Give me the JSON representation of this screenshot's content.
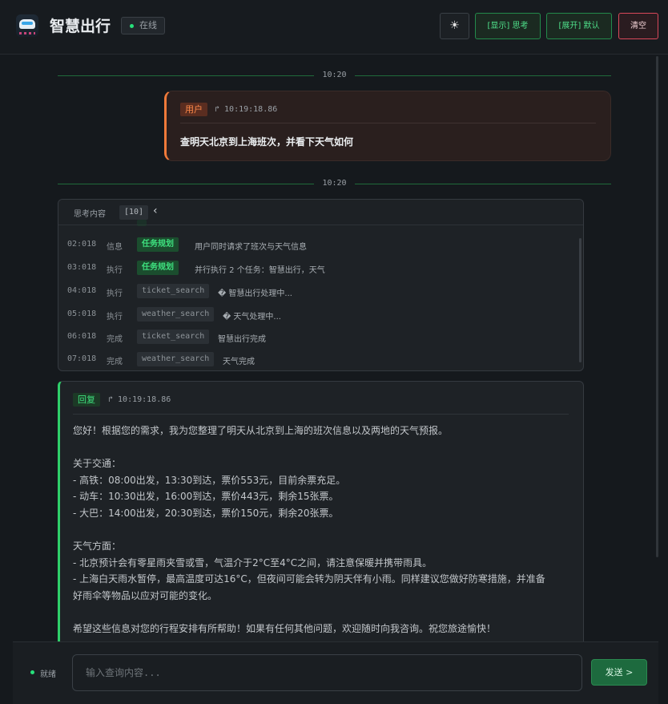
{
  "header": {
    "title": "智慧出行",
    "status": "在线",
    "theme_icon": "☀",
    "btn_think": "[显示] 思考",
    "btn_expand": "[展开] 默认",
    "btn_clear": "清空"
  },
  "dividers": [
    "10:20",
    "10:20"
  ],
  "user_message": {
    "tag": "用户",
    "time": "↱ 10:19:18.86",
    "text": "查明天北京到上海班次，并看下天气如何"
  },
  "thinking": {
    "label": "思考内容",
    "count": "[10]",
    "rows": [
      {
        "time": "02:018",
        "type": "信息",
        "tag": "任务规划",
        "tag_kind": "plan",
        "text": "用户同时请求了班次与天气信息"
      },
      {
        "time": "03:018",
        "type": "执行",
        "tag": "任务规划",
        "tag_kind": "plan",
        "text": "并行执行 2 个任务：智慧出行，天气"
      },
      {
        "time": "04:018",
        "type": "执行",
        "tag": "ticket_search",
        "tag_kind": "tool",
        "text": "� 智慧出行处理中..."
      },
      {
        "time": "05:018",
        "type": "执行",
        "tag": "weather_search",
        "tag_kind": "tool",
        "text": "� 天气处理中..."
      },
      {
        "time": "06:018",
        "type": "完成",
        "tag": "ticket_search",
        "tag_kind": "tool",
        "text": "智慧出行完成"
      },
      {
        "time": "07:018",
        "type": "完成",
        "tag": "weather_search",
        "tag_kind": "tool",
        "text": "天气完成"
      }
    ]
  },
  "reply": {
    "tag": "回复",
    "time": "↱ 10:19:18.86",
    "lines": [
      "您好！根据您的需求，我为您整理了明天从北京到上海的班次信息以及两地的天气预报。",
      "",
      "关于交通：",
      "- 高铁：08:00出发，13:30到达，票价553元，目前余票充足。",
      "- 动车：10:30出发，16:00到达，票价443元，剩余15张票。",
      "- 大巴：14:00出发，20:30到达，票价150元，剩余20张票。",
      "",
      "天气方面：",
      "- 北京预计会有零星雨夹雪或雪，气温介于2°C至4°C之间，请注意保暖并携带雨具。",
      "- 上海白天雨水暂停，最高温度可达16°C，但夜间可能会转为阴天伴有小雨。同样建议您做好防寒措施，并准备",
      "好雨伞等物品以应对可能的变化。",
      "",
      "希望这些信息对您的行程安排有所帮助！如果有任何其他问题，欢迎随时向我咨询。祝您旅途愉快！"
    ]
  },
  "footer": {
    "status": "就绪",
    "placeholder": "输入查询内容...",
    "send": "发送 >"
  },
  "colors": {
    "accent": "#2fcf6a",
    "user_accent": "#f07a3a",
    "danger": "#d9485a"
  }
}
